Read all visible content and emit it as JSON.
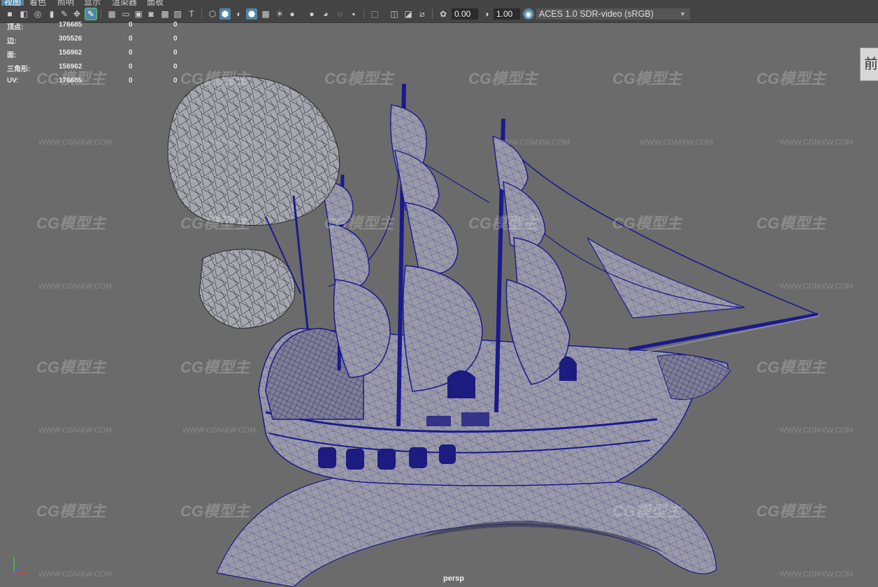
{
  "menu": {
    "items": [
      "视图",
      "着色",
      "照明",
      "显示",
      "渲染器",
      "面板"
    ]
  },
  "toolbar": {
    "exposure_value": "0.00",
    "gamma_value": "1.00",
    "color_space": "ACES 1.0 SDR-video (sRGB)"
  },
  "hud": {
    "rows": [
      {
        "label": "顶点:",
        "v1": "176685",
        "v2": "0",
        "v3": "0"
      },
      {
        "label": "边:",
        "v1": "305526",
        "v2": "0",
        "v3": "0"
      },
      {
        "label": "面:",
        "v1": "156962",
        "v2": "0",
        "v3": "0"
      },
      {
        "label": "三角形:",
        "v1": "156962",
        "v2": "0",
        "v3": "0"
      },
      {
        "label": "UV:",
        "v1": "176685",
        "v2": "0",
        "v3": "0"
      }
    ]
  },
  "viewcube": {
    "label": "前"
  },
  "camera_label": "persp",
  "watermark": {
    "text": "CG模型主",
    "url": "WWW.CGMXW.COM"
  },
  "colors": {
    "wire": "#1a1a8c",
    "mesh_fill": "#9a9aa8",
    "viewport_bg": "#6b6b6b",
    "highlight": "#5285a6"
  }
}
